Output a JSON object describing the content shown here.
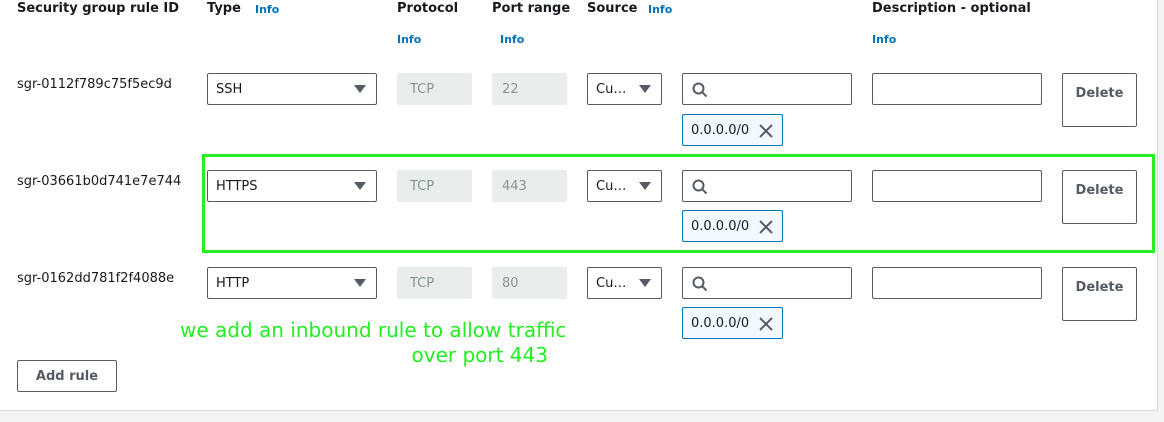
{
  "columns": {
    "rule_id": "Security group rule ID",
    "type": "Type",
    "type_info": "Info",
    "protocol": "Protocol",
    "protocol_info": "Info",
    "port_range": "Port range",
    "port_range_info": "Info",
    "source": "Source",
    "source_info": "Info",
    "description": "Description - optional",
    "description_info": "Info"
  },
  "rules": [
    {
      "id": "sgr-0112f789c75f5ec9d",
      "type": "SSH",
      "protocol": "TCP",
      "port": "22",
      "source_type": "Cu…",
      "search_value": "",
      "cidr": "0.0.0.0/0",
      "description": "",
      "delete_label": "Delete"
    },
    {
      "id": "sgr-03661b0d741e7e744",
      "type": "HTTPS",
      "protocol": "TCP",
      "port": "443",
      "source_type": "Cu…",
      "search_value": "",
      "cidr": "0.0.0.0/0",
      "description": "",
      "delete_label": "Delete"
    },
    {
      "id": "sgr-0162dd781f2f4088e",
      "type": "HTTP",
      "protocol": "TCP",
      "port": "80",
      "source_type": "Cu…",
      "search_value": "",
      "cidr": "0.0.0.0/0",
      "description": "",
      "delete_label": "Delete"
    }
  ],
  "add_rule_label": "Add rule",
  "annotation": {
    "line1": "we add an inbound rule to allow traffic",
    "line2": "over port 443",
    "color": "#22ee22"
  },
  "icons": {
    "select_caret": "caret-down-icon",
    "search": "search-icon",
    "remove_token": "close-icon"
  },
  "colors": {
    "link": "#0073bb",
    "highlight": "#28ee28",
    "token_border": "#0073bb"
  }
}
